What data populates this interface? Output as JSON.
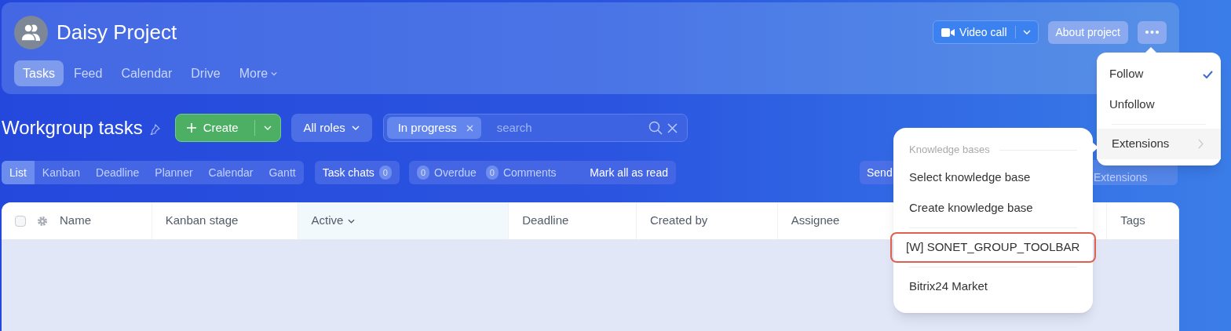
{
  "header": {
    "title": "Daisy Project",
    "tabs": [
      {
        "label": "Tasks",
        "selected": true
      },
      {
        "label": "Feed",
        "selected": false
      },
      {
        "label": "Calendar",
        "selected": false
      },
      {
        "label": "Drive",
        "selected": false
      }
    ],
    "more": "More",
    "video_call": "Video call",
    "about": "About project"
  },
  "toolbar": {
    "title": "Workgroup tasks",
    "create": "Create",
    "roles": "All roles",
    "filter_chip": "In progress",
    "search_placeholder": "search"
  },
  "views": [
    {
      "label": "List",
      "selected": true
    },
    {
      "label": "Kanban",
      "selected": false
    },
    {
      "label": "Deadline",
      "selected": false
    },
    {
      "label": "Planner",
      "selected": false
    },
    {
      "label": "Calendar",
      "selected": false
    },
    {
      "label": "Gantt",
      "selected": false
    }
  ],
  "task_chats": {
    "label": "Task chats",
    "count": "0"
  },
  "counters": [
    {
      "count": "0",
      "label": "Overdue"
    },
    {
      "count": "0",
      "label": "Comments"
    }
  ],
  "mark_read": "Mark all as read",
  "send": "Send",
  "extensions_button": "Extensions",
  "table": {
    "columns": [
      {
        "label": "Name",
        "sorted": false
      },
      {
        "label": "Kanban stage",
        "sorted": false
      },
      {
        "label": "Active",
        "sorted": true
      },
      {
        "label": "Deadline",
        "sorted": false
      },
      {
        "label": "Created by",
        "sorted": false
      },
      {
        "label": "Assignee",
        "sorted": false
      },
      {
        "label": "Tags",
        "sorted": false
      }
    ]
  },
  "menu": {
    "items": [
      {
        "kind": "item",
        "label": "Follow",
        "checked": true
      },
      {
        "kind": "item",
        "label": "Unfollow",
        "checked": false
      },
      {
        "kind": "separator"
      },
      {
        "kind": "submenu",
        "label": "Extensions",
        "selected": true
      }
    ]
  },
  "submenu": {
    "items": [
      {
        "kind": "header",
        "label": "Knowledge bases"
      },
      {
        "kind": "item",
        "label": "Select knowledge base",
        "highlighted": false
      },
      {
        "kind": "item",
        "label": "Create knowledge base",
        "highlighted": false
      },
      {
        "kind": "separator"
      },
      {
        "kind": "item",
        "label": "[W] SONET_GROUP_TOOLBAR",
        "highlighted": true
      },
      {
        "kind": "separator"
      },
      {
        "kind": "item",
        "label": "Bitrix24 Market",
        "highlighted": false
      }
    ]
  }
}
